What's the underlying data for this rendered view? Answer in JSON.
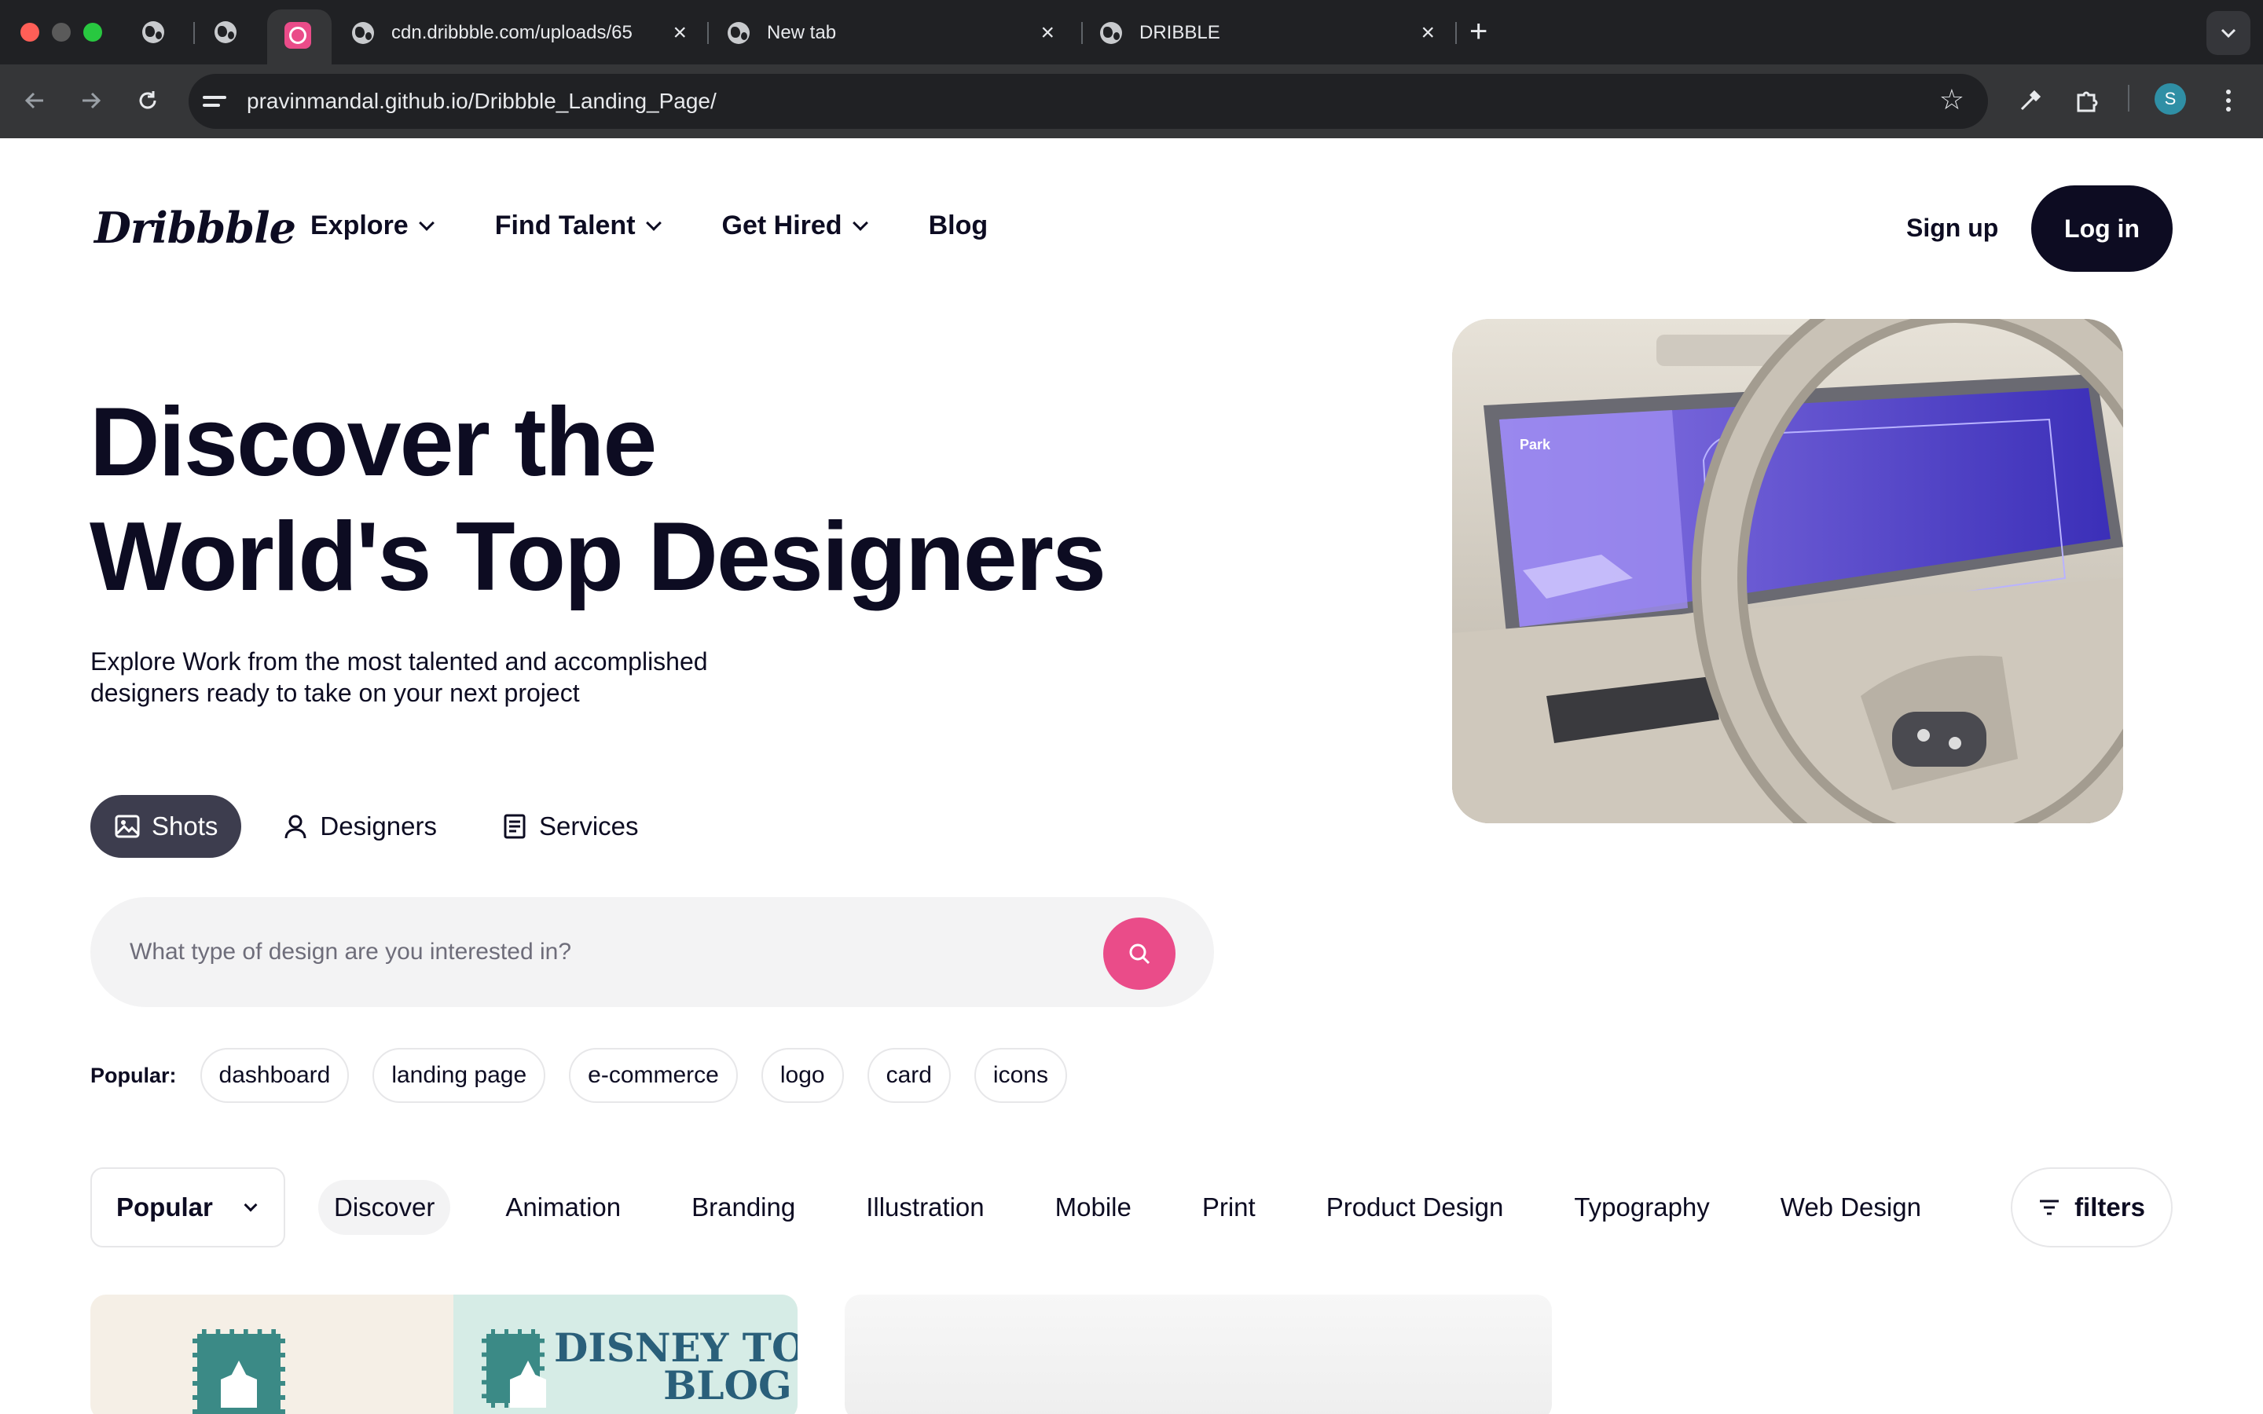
{
  "browser": {
    "tabs": [
      {
        "title": "cdn.dribbble.com/uploads/65"
      },
      {
        "title": "New tab"
      },
      {
        "title": "DRIBBLE"
      }
    ],
    "url_host": "pravinmandal.github.io",
    "url_path": "/Dribbble_Landing_Page/",
    "profile_initial": "S"
  },
  "header": {
    "logo": "Dribbble",
    "nav": [
      {
        "label": "Explore"
      },
      {
        "label": "Find Talent"
      },
      {
        "label": "Get Hired"
      },
      {
        "label": "Blog"
      }
    ],
    "signup": "Sign up",
    "login": "Log in"
  },
  "hero": {
    "title_line1": "Discover the",
    "title_line2": "World's Top Designers",
    "subtitle": "Explore Work from the most talented and accomplished designers ready to take on your next project",
    "media_label": "Park"
  },
  "segments": [
    {
      "label": "Shots",
      "icon": "image-icon",
      "active": true
    },
    {
      "label": "Designers",
      "icon": "person-icon",
      "active": false
    },
    {
      "label": "Services",
      "icon": "document-icon",
      "active": false
    }
  ],
  "search": {
    "placeholder": "What type of design are you interested in?"
  },
  "popular": {
    "label": "Popular:",
    "tags": [
      "dashboard",
      "landing page",
      "e-commerce",
      "logo",
      "card",
      "icons"
    ]
  },
  "filterbar": {
    "sort_value": "Popular",
    "categories": [
      "Discover",
      "Animation",
      "Branding",
      "Illustration",
      "Mobile",
      "Print",
      "Product Design",
      "Typography",
      "Web Design"
    ],
    "active_category": "Discover",
    "filters_label": "filters"
  },
  "shots": [
    {
      "text_line1": "DISNEY TOURS",
      "text_line2": "BLOG"
    },
    {}
  ],
  "colors": {
    "accent": "#ea4c89",
    "ink": "#0d0c22",
    "active_segment": "#3d3d4e"
  }
}
